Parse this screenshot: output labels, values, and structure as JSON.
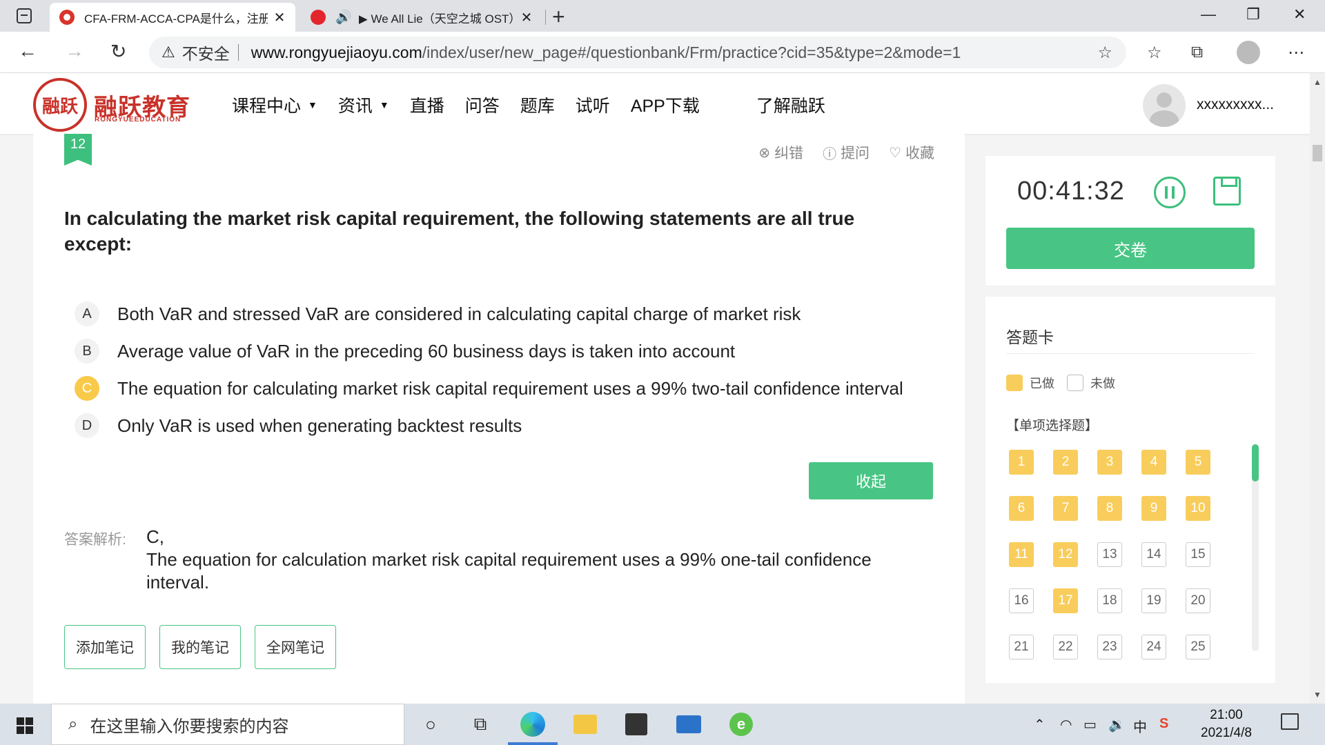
{
  "browser": {
    "tabs": [
      {
        "title": "CFA-FRM-ACCA-CPA是什么，注册",
        "close": "✕"
      },
      {
        "title": "▶ We All Lie（天空之城 OST）",
        "close": "✕"
      }
    ],
    "new_tab": "+",
    "address": {
      "warning": "不安全",
      "domain": "www.rongyuejiaoyu.com",
      "path": "/index/user/new_page#/questionbank/Frm/practice?cid=35&type=2&mode=1"
    }
  },
  "site": {
    "logo_glyph": "融跃",
    "logo_text": "融跃教育",
    "logo_sub": "RONGYUEEDUCATION",
    "nav": [
      "课程中心",
      "资讯",
      "直播",
      "问答",
      "题库",
      "试听",
      "APP下载",
      "了解融跃"
    ],
    "username": "xxxxxxxxx..."
  },
  "question": {
    "number": "12",
    "tools": {
      "correct": "纠错",
      "ask": "提问",
      "favorite": "收藏"
    },
    "text": "In calculating the market risk capital requirement, the following statements are all true except:",
    "options": [
      {
        "letter": "A",
        "text": "Both VaR and stressed VaR are considered in calculating capital charge of market risk",
        "selected": false
      },
      {
        "letter": "B",
        "text": "Average value of VaR in the preceding 60 business days is taken into account",
        "selected": false
      },
      {
        "letter": "C",
        "text": "The equation for calculating market risk capital requirement uses a 99% two-tail confidence interval",
        "selected": true
      },
      {
        "letter": "D",
        "text": "Only VaR is used when generating backtest results",
        "selected": false
      }
    ],
    "collapse_label": "收起",
    "analysis_label": "答案解析:",
    "answer": "C,",
    "explanation": "The equation for calculation market risk capital requirement uses a 99% one-tail confidence interval."
  },
  "notes": {
    "add": "添加笔记",
    "mine": "我的笔记",
    "all": "全网笔记"
  },
  "sidebar": {
    "timer": "00:41:32",
    "submit_label": "交卷",
    "card_title": "答题卡",
    "legend_done": "已做",
    "legend_todo": "未做",
    "section": "【单项选择题】",
    "done_numbers": [
      1,
      2,
      3,
      4,
      5,
      6,
      7,
      8,
      9,
      10,
      11,
      12,
      17
    ],
    "numbers": [
      "1",
      "2",
      "3",
      "4",
      "5",
      "6",
      "7",
      "8",
      "9",
      "10",
      "11",
      "12",
      "13",
      "14",
      "15",
      "16",
      "17",
      "18",
      "19",
      "20",
      "21",
      "22",
      "23",
      "24",
      "25"
    ]
  },
  "taskbar": {
    "search_placeholder": "在这里输入你要搜索的内容",
    "time": "21:00",
    "date": "2021/4/8",
    "ime": "中"
  }
}
